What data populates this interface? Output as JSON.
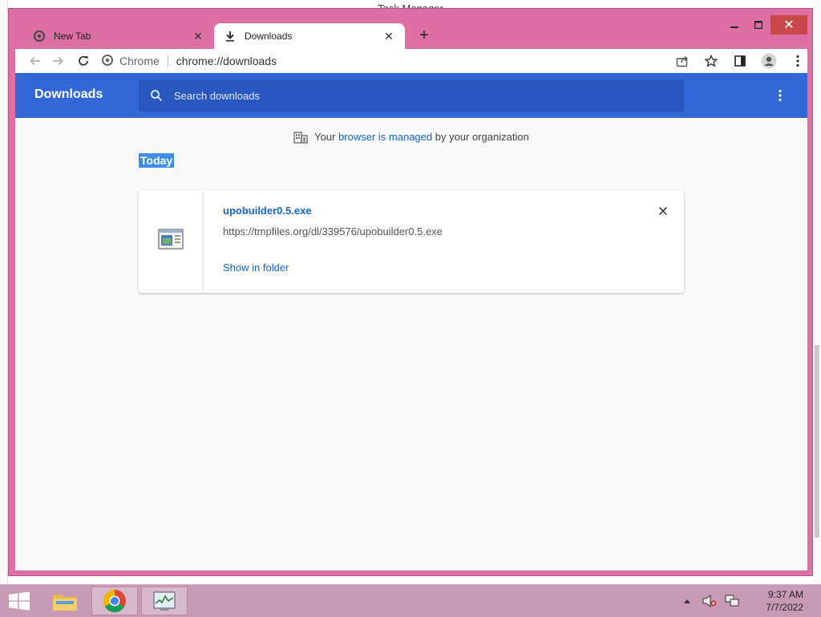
{
  "background_window": {
    "title": "Task Manager"
  },
  "tabs": [
    {
      "title": "New Tab",
      "icon": "chrome-icon"
    },
    {
      "title": "Downloads",
      "icon": "download-icon"
    }
  ],
  "omnibox": {
    "site_chip": "Chrome",
    "url": "chrome://downloads"
  },
  "downloads_page": {
    "title": "Downloads",
    "search_placeholder": "Search downloads",
    "managed_notice": {
      "prefix": "Your ",
      "link": "browser is managed",
      "suffix": " by your organization"
    },
    "section_label": "Today",
    "items": [
      {
        "filename": "upobuilder0.5.exe",
        "url": "https://tmpfiles.org/dl/339576/upobuilder0.5.exe",
        "action": "Show in folder"
      }
    ]
  },
  "taskbar": {
    "time": "9:37 AM",
    "date": "7/7/2022"
  },
  "colors": {
    "header_blue": "#3367d6",
    "link_blue": "#1a63c8",
    "window_frame": "#dd6fa5",
    "taskbar": "#c89ab6"
  }
}
